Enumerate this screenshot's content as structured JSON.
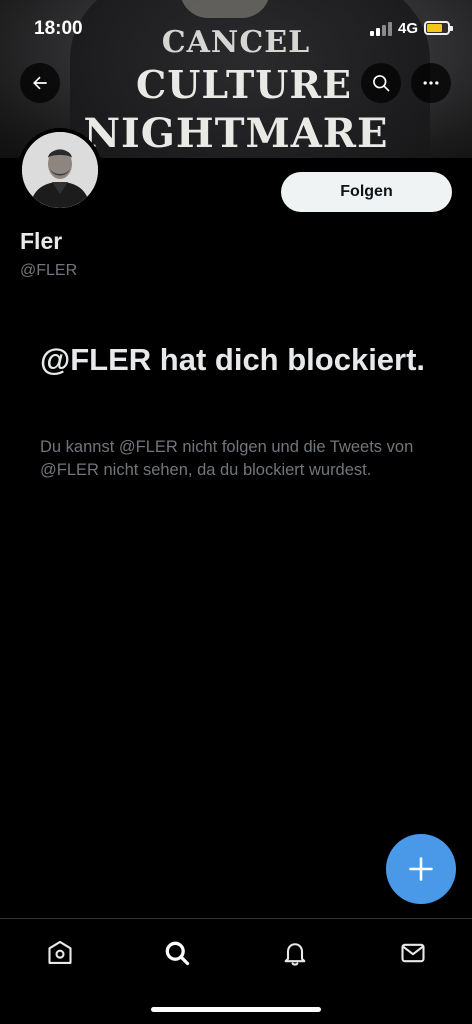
{
  "status_bar": {
    "time": "18:00",
    "network": "4G",
    "battery_level": 0.75,
    "battery_color": "#f5c518"
  },
  "banner": {
    "lines": [
      "CANCEL",
      "CULTURE",
      "NIGHTMARE"
    ]
  },
  "header_actions": {
    "back_icon": "arrow-left-icon",
    "search_icon": "search-icon",
    "more_icon": "more-horizontal-icon"
  },
  "profile": {
    "display_name": "Fler",
    "handle": "@FLER",
    "follow_label": "Folgen"
  },
  "blocked_notice": {
    "title": "@FLER hat dich blockiert.",
    "description": "Du kannst @FLER nicht folgen und die Tweets von @FLER nicht sehen, da du blockiert wurdest."
  },
  "fab": {
    "icon": "plus-icon",
    "color": "#4a99e9"
  },
  "bottom_nav": {
    "items": [
      {
        "name": "home",
        "icon": "home-icon"
      },
      {
        "name": "search",
        "icon": "search-icon"
      },
      {
        "name": "notifications",
        "icon": "bell-icon"
      },
      {
        "name": "messages",
        "icon": "mail-icon"
      }
    ]
  }
}
